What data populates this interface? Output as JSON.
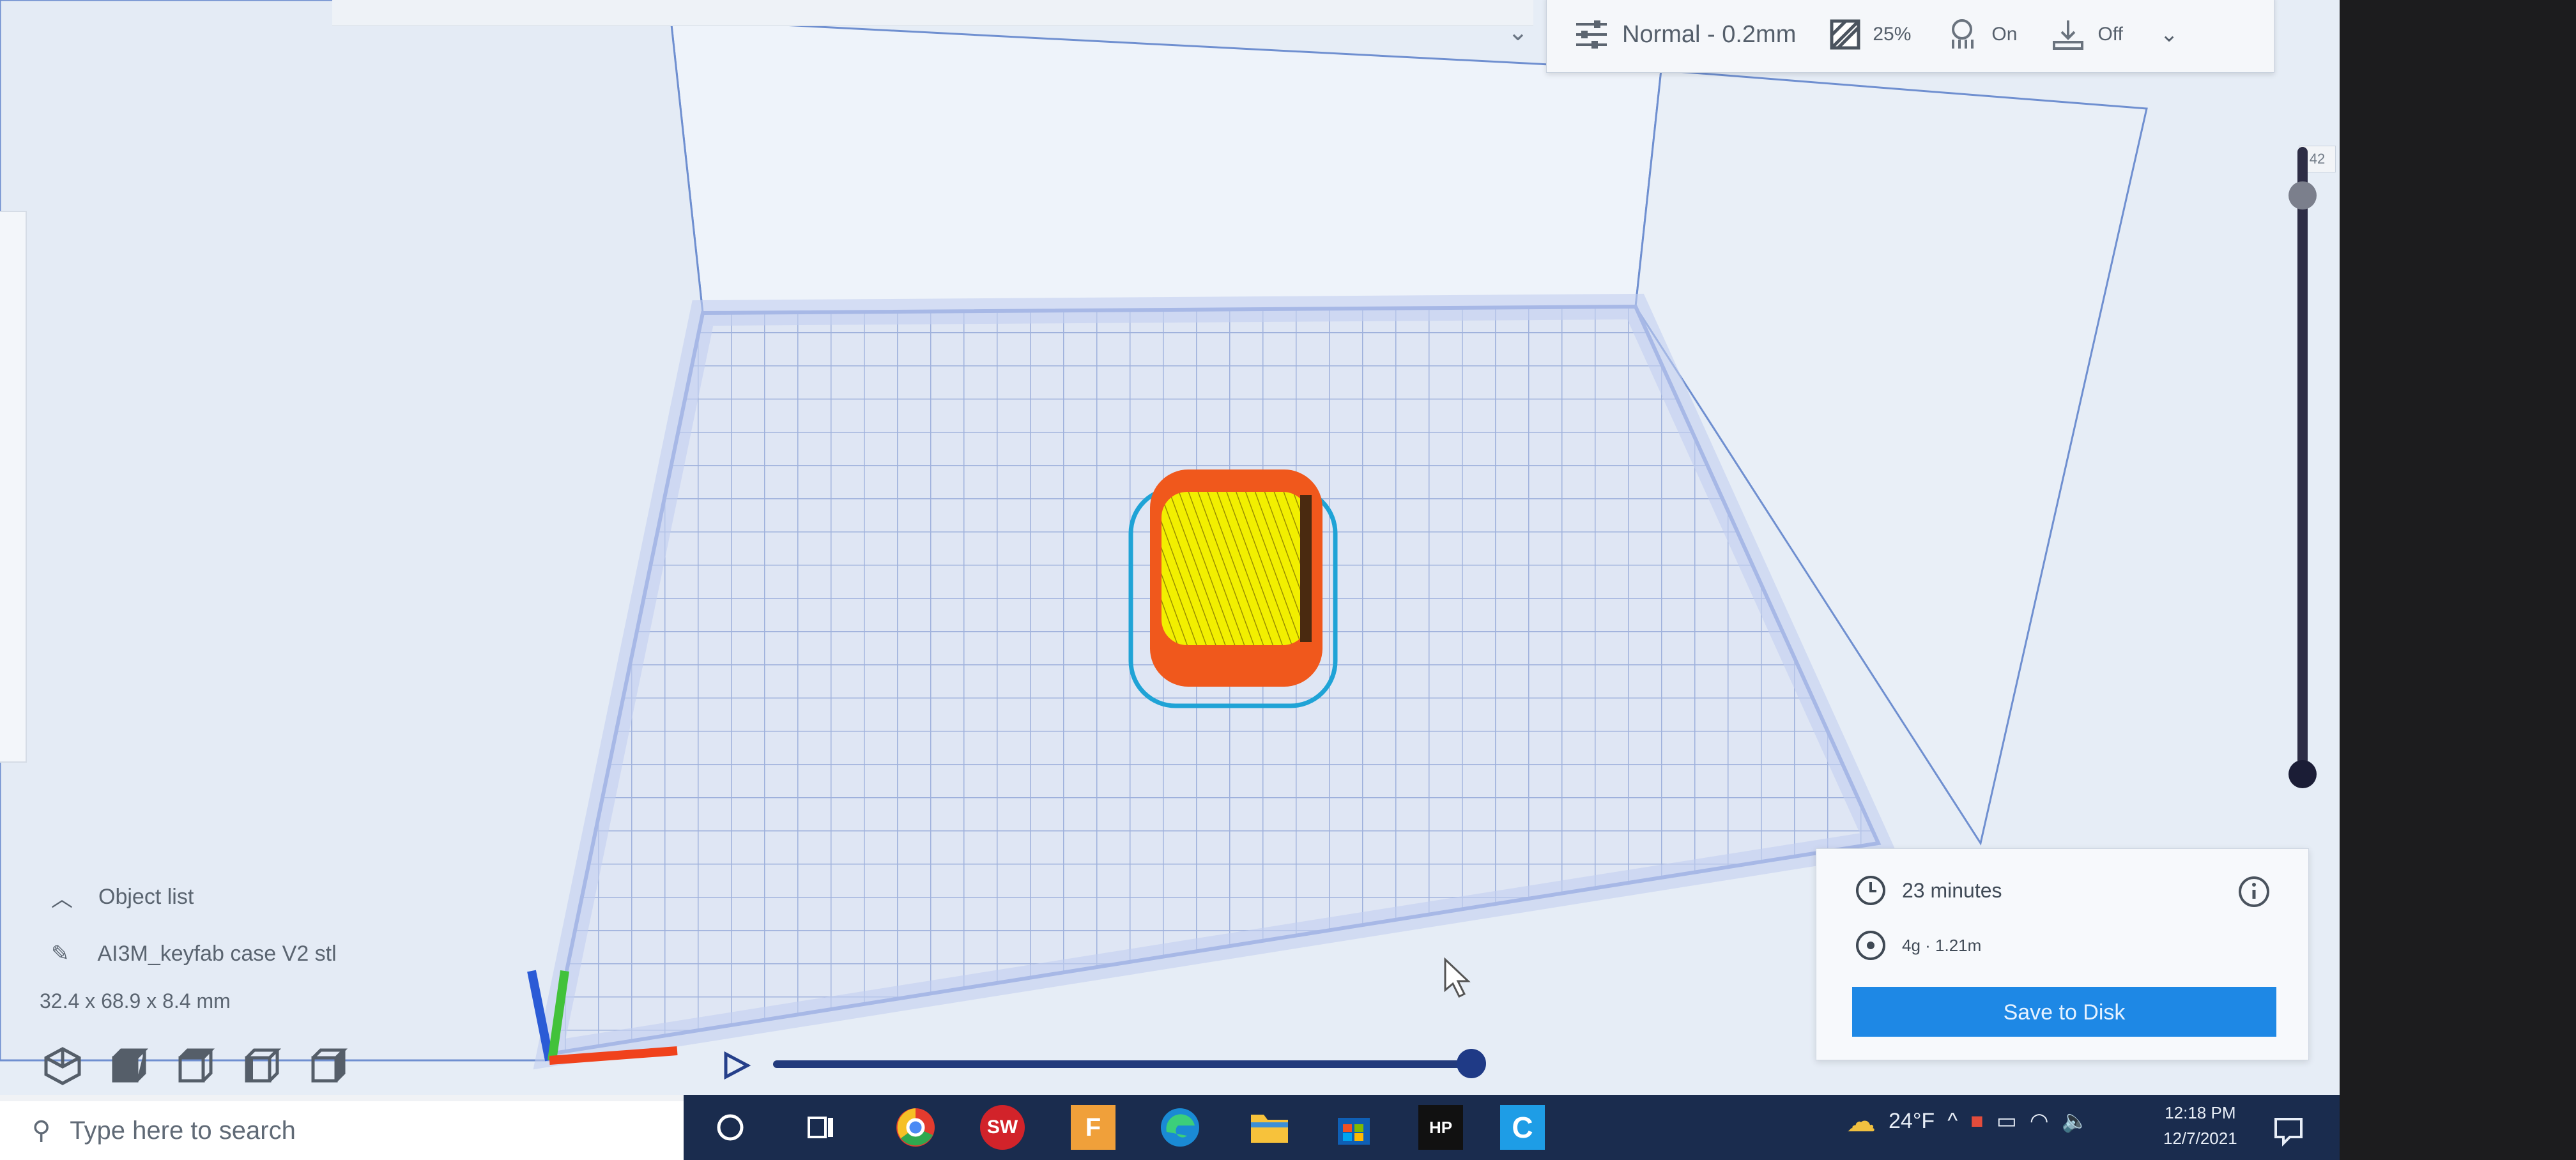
{
  "settings_bar": {
    "profile": "Normal - 0.2mm",
    "infill": "25%",
    "support": "On",
    "adhesion": "Off"
  },
  "layer_slider": {
    "top_label": "42"
  },
  "object_list": {
    "header": "Object list",
    "object_name": "AI3M_keyfab case V2 stl",
    "dimensions": "32.4 x 68.9 x 8.4 mm"
  },
  "print_info": {
    "time": "23 minutes",
    "material": "4g · 1.21m",
    "save_label": "Save to Disk"
  },
  "taskbar": {
    "search_placeholder": "Type here to search",
    "apps": [
      "cortana-icon",
      "task-view-icon",
      "chrome-icon",
      "solidworks-icon",
      "fusion-icon",
      "edge-icon",
      "file-explorer-icon",
      "store-icon",
      "hp-icon",
      "cura-icon"
    ],
    "weather": "24°F",
    "time": "12:18 PM",
    "date": "12/7/2021"
  },
  "colors": {
    "accent": "#1e88e5",
    "wall": "#e8700f",
    "infill": "#e8e800",
    "skirt": "#29b6f6",
    "build_plate_grid": "#a9b9e0"
  }
}
